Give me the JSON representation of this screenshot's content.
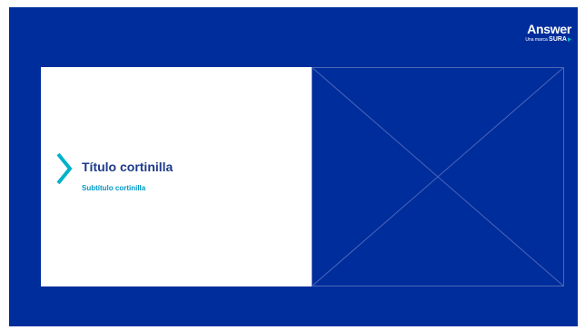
{
  "logo": {
    "name": "Answer",
    "tagline_prefix": "Una marca",
    "tagline_brand": "SURA"
  },
  "content": {
    "title": "Título cortinilla",
    "subtitle": "Subtítulo cortinilla"
  },
  "icons": {
    "chevron": "chevron-right-icon",
    "image_placeholder": "image-placeholder-icon"
  },
  "colors": {
    "background": "#002d9c",
    "card": "#ffffff",
    "accent": "#00b2c9",
    "title": "#1d3a8a",
    "subtitle": "#0099c6",
    "placeholder_lines": "#4a68b8"
  }
}
